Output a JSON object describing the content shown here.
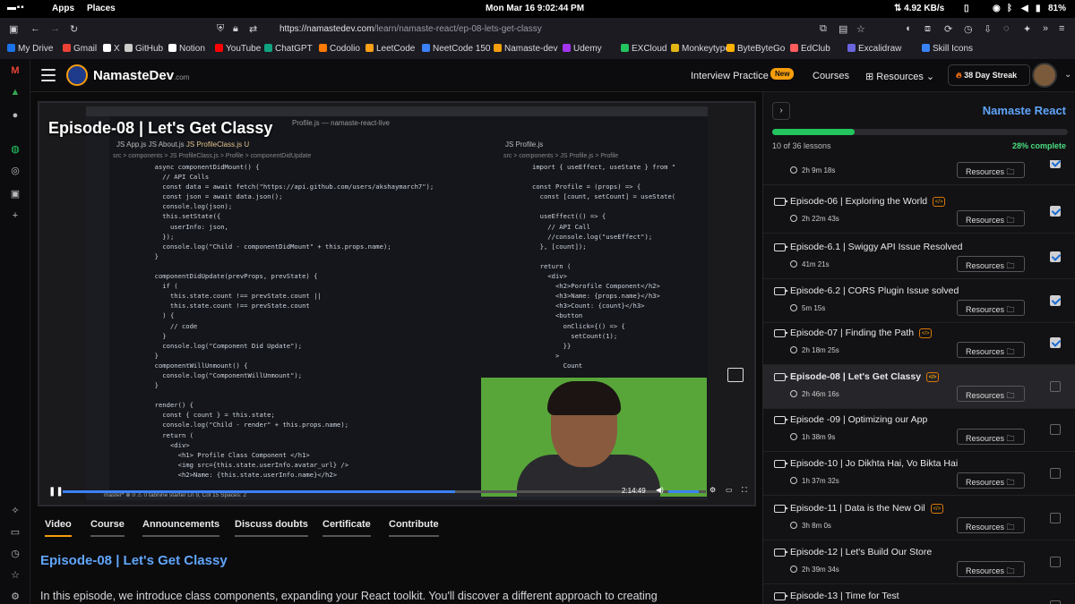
{
  "system": {
    "apps": "Apps",
    "places": "Places",
    "datetime": "Mon Mar 16   9:02:44 PM",
    "netspeed": "⇅ 4.92 KB/s",
    "battery": "81%"
  },
  "browser": {
    "url_base": "https://namastedev.com",
    "url_path": "/learn/namaste-react/ep-08-lets-get-classy",
    "bookmarks": [
      "My Drive",
      "Gmail",
      "X",
      "GitHub",
      "Notion",
      "YouTube",
      "ChatGPT",
      "Codolio",
      "LeetCode",
      "NeetCode 150",
      "Namaste-dev",
      "Udemy",
      "EXCloud",
      "Monkeytype",
      "ByteByteGo",
      "EdClub",
      "Excalidraw",
      "Skill Icons"
    ]
  },
  "navbar": {
    "logo": "NamasteDev",
    "logo_suffix": ".com",
    "interview": "Interview Practice",
    "new_badge": "New",
    "courses": "Courses",
    "resources": "Resources",
    "streak": "38 Day Streak"
  },
  "video": {
    "overlay_title": "Episode-08 | Let's Get Classy",
    "time": "2:14:49",
    "progress": 0.61,
    "tab1": "JS App.js",
    "tab2": "JS About.js",
    "tab3": "JS ProfileClass.js U",
    "tab4": "JS Profile.js",
    "window_title": "Profile.js — namaste-react-live",
    "breadcrumb_left": "src > components > JS ProfileClass.js > Profile > componentDidUpdate",
    "breadcrumb_right": "src > components > JS Profile.js > Profile",
    "code_left": "  async componentDidMount() {\n    // API Calls\n    const data = await fetch(\"https://api.github.com/users/akshaymarch7\");\n    const json = await data.json();\n    console.log(json);\n    this.setState({\n      userInfo: json,\n    });\n    console.log(\"Child - componentDidMount\" + this.props.name);\n  }\n\n  componentDidUpdate(prevProps, prevState) {\n    if (\n      this.state.count !== prevState.count ||\n      this.state.count !== prevState.count\n    ) {\n      // code\n    }\n    console.log(\"Component Did Update\");\n  }\n  componentWillUnmount() {\n    console.log(\"ComponentWillUnmount\");\n  }\n\n  render() {\n    const { count } = this.state;\n    console.log(\"Child - render\" + this.props.name);\n    return (\n      <div>\n        <h1> Profile Class Component </h1>\n        <img src={this.state.userInfo.avatar_url} />\n        <h2>Name: {this.state.userInfo.name}</h2>",
    "code_right": "import { useEffect, useState } from \"\n\nconst Profile = (props) => {\n  const [count, setCount] = useState(\n\n  useEffect(() => {\n    // API Call\n    //console.log(\"useEffect\");\n  }, [count]);\n\n  return (\n    <div>\n      <h2>Porofile Component</h2>\n      <h3>Name: {props.name}</h3>\n      <h3>Count: {count}</h3>\n      <button\n        onClick={() => {\n          setCount(1);\n        }}\n      >\n        Count",
    "status_bar": "master*   ⊗ 0 ⚠ 0   tabnine starter          Ln 9, Col 15   Spaces: 2"
  },
  "tabs": [
    "Video",
    "Course",
    "Announcements",
    "Discuss doubts",
    "Certificate",
    "Contribute"
  ],
  "episode_title": "Episode-08 | Let's Get Classy",
  "description": "In this episode, we introduce class components, expanding your React toolkit. You'll discover a different approach to creating",
  "sidebar": {
    "course": "Namaste React",
    "lessons_done": "10 of 36 lessons",
    "pct_text": "28% complete",
    "progress": 0.28,
    "resources_label": "Resources",
    "lessons": [
      {
        "title": "",
        "duration": "2h 9m 18s",
        "code": true,
        "done": true
      },
      {
        "title": "Episode-06 | Exploring the World",
        "duration": "2h 22m 43s",
        "code": true,
        "done": true
      },
      {
        "title": "Episode-6.1 | Swiggy API Issue Resolved",
        "duration": "41m 21s",
        "code": false,
        "done": true
      },
      {
        "title": "Episode-6.2 | CORS Plugin Issue solved",
        "duration": "5m 15s",
        "code": false,
        "done": true
      },
      {
        "title": "Episode-07 | Finding the Path",
        "duration": "2h 18m 25s",
        "code": true,
        "done": true
      },
      {
        "title": "Episode-08 | Let's Get Classy",
        "duration": "2h 46m 16s",
        "code": true,
        "done": false,
        "current": true
      },
      {
        "title": "Episode -09 | Optimizing our App",
        "duration": "1h 38m 9s",
        "code": false,
        "done": false
      },
      {
        "title": "Episode-10 | Jo Dikhta Hai, Vo Bikta Hai",
        "duration": "1h 37m 32s",
        "code": false,
        "done": false
      },
      {
        "title": "Episode-11 | Data is the New Oil",
        "duration": "3h 8m 0s",
        "code": true,
        "done": false
      },
      {
        "title": "Episode-12 | Let's Build Our Store",
        "duration": "2h 39m 34s",
        "code": false,
        "done": false
      },
      {
        "title": "Episode-13 | Time for Test",
        "duration": "",
        "code": false,
        "done": false
      }
    ]
  }
}
